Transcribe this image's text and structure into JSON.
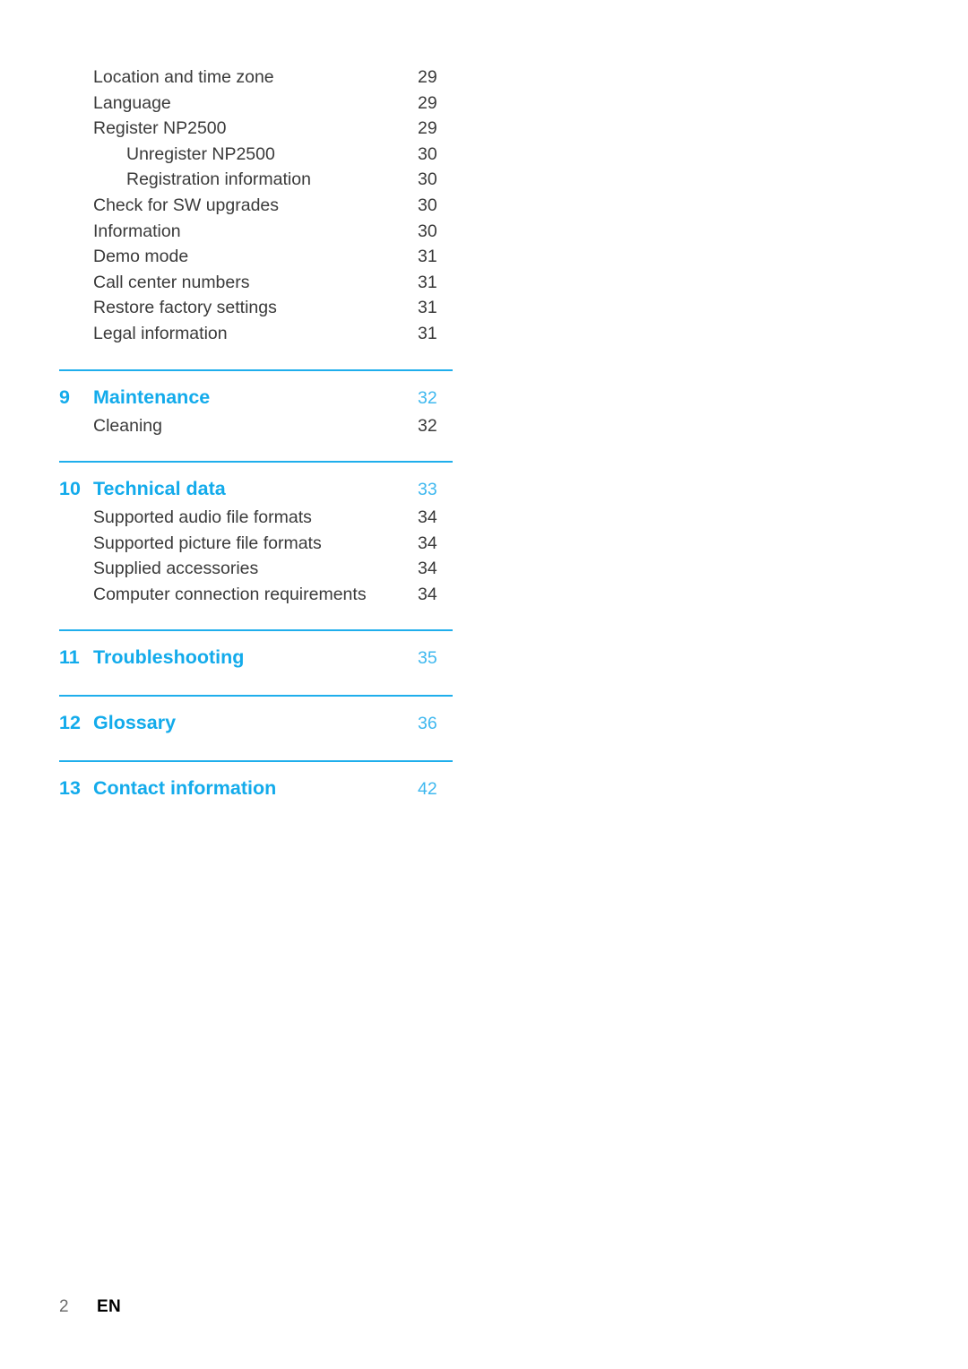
{
  "document": {
    "type": "table-of-contents",
    "footer": {
      "page_number": "2",
      "language_code": "EN"
    },
    "colors": {
      "chapter_heading": "#13ABEB",
      "chapter_page_number": "#3FB8EF",
      "rule": "#1FAEEC",
      "body_text": "#3a3a3a",
      "footer_page_number": "#6d6d6d",
      "footer_language": "#000000"
    }
  },
  "settings_entries": [
    {
      "title": "Location and time zone",
      "page": "29",
      "level": 1
    },
    {
      "title": "Language",
      "page": "29",
      "level": 1
    },
    {
      "title": "Register NP2500",
      "page": "29",
      "level": 1
    },
    {
      "title": "Unregister NP2500",
      "page": "30",
      "level": 2
    },
    {
      "title": "Registration information",
      "page": "30",
      "level": 2
    },
    {
      "title": "Check for SW upgrades",
      "page": "30",
      "level": 1
    },
    {
      "title": "Information",
      "page": "30",
      "level": 1
    },
    {
      "title": "Demo mode",
      "page": "31",
      "level": 1
    },
    {
      "title": "Call center numbers",
      "page": "31",
      "level": 1
    },
    {
      "title": "Restore factory settings",
      "page": "31",
      "level": 1
    },
    {
      "title": "Legal information",
      "page": "31",
      "level": 1
    }
  ],
  "chapters": [
    {
      "number": "9",
      "title": "Maintenance",
      "page": "32",
      "entries": [
        {
          "title": "Cleaning",
          "page": "32",
          "level": 1
        }
      ]
    },
    {
      "number": "10",
      "title": "Technical data",
      "page": "33",
      "entries": [
        {
          "title": "Supported audio file formats",
          "page": "34",
          "level": 1
        },
        {
          "title": "Supported picture file formats",
          "page": "34",
          "level": 1
        },
        {
          "title": "Supplied accessories",
          "page": "34",
          "level": 1
        },
        {
          "title": "Computer connection requirements",
          "page": "34",
          "level": 1
        }
      ]
    },
    {
      "number": "11",
      "title": "Troubleshooting",
      "page": "35",
      "entries": []
    },
    {
      "number": "12",
      "title": "Glossary",
      "page": "36",
      "entries": []
    },
    {
      "number": "13",
      "title": "Contact information",
      "page": "42",
      "entries": []
    }
  ]
}
